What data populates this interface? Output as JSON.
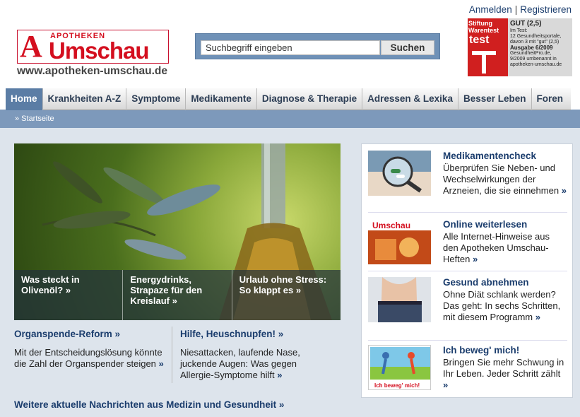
{
  "header": {
    "login": "Anmelden",
    "separator": "|",
    "register": "Registrieren",
    "logo_small": "APOTHEKEN",
    "logo_big": "Umschau",
    "logo_mark": "A",
    "url": "www.apotheken-umschau.de",
    "search_placeholder": "Suchbegriff eingeben",
    "search_button": "Suchen",
    "badge": {
      "brand1": "Stiftung",
      "brand2": "Warentest",
      "test": "test",
      "grade": "GUT (2,5)",
      "line1": "Im Test:",
      "line2": "12 Gesundheitsportale,",
      "line3": "davon 3 mit \"gut\" (2,5)",
      "edition": "Ausgabe 6/2009",
      "line4": "GesundheitPro.de,",
      "line5": "9/2009 umbenannt in",
      "line6": "apotheken-umschau.de"
    }
  },
  "nav": {
    "items": [
      "Home",
      "Krankheiten A-Z",
      "Symptome",
      "Medikamente",
      "Diagnose & Therapie",
      "Adressen & Lexika",
      "Besser Leben",
      "Foren"
    ],
    "active": 0
  },
  "breadcrumb": "» Startseite",
  "hero": {
    "captions": [
      {
        "line1": "Was steckt in",
        "line2": "Olivenöl? »"
      },
      {
        "line1": "Energydrinks,",
        "line2": "Strapaze für den",
        "line3": "Kreislauf »"
      },
      {
        "line1": "Urlaub ohne Stress:",
        "line2": "So klappt es »"
      }
    ]
  },
  "news": [
    {
      "title": "Organspende-Reform »",
      "text": "Mit der Entscheidungslösung könnte die Zahl der Organspender steigen",
      "arrow": "»"
    },
    {
      "title": "Hilfe, Heuschnupfen! »",
      "text": "Niesattacken, laufende Nase, juckende Augen: Was gegen Allergie-Symptome hilft",
      "arrow": "»"
    }
  ],
  "more_link": "Weitere aktuelle Nachrichten aus Medizin und Gesundheit »",
  "sidebar": [
    {
      "title": "Medikamentencheck",
      "text": "Überprüfen Sie Neben- und Wechselwirkungen der Arzneien, die sie einnehmen",
      "arrow": "»"
    },
    {
      "title": "Online weiterlesen",
      "text": "Alle Internet-Hinweise aus den Apotheken Umschau-Heften",
      "arrow": "»",
      "thumb_label": "Umschau"
    },
    {
      "title": "Gesund abnehmen",
      "text": "Ohne Diät schlank werden? Das geht: In sechs Schritten, mit diesem Programm",
      "arrow": "»"
    },
    {
      "title": "Ich beweg' mich!",
      "text": "Bringen Sie mehr Schwung in Ihr Leben. Jeder Schritt zählt",
      "arrow": "»",
      "thumb_label": "Ich beweg' mich!"
    }
  ]
}
